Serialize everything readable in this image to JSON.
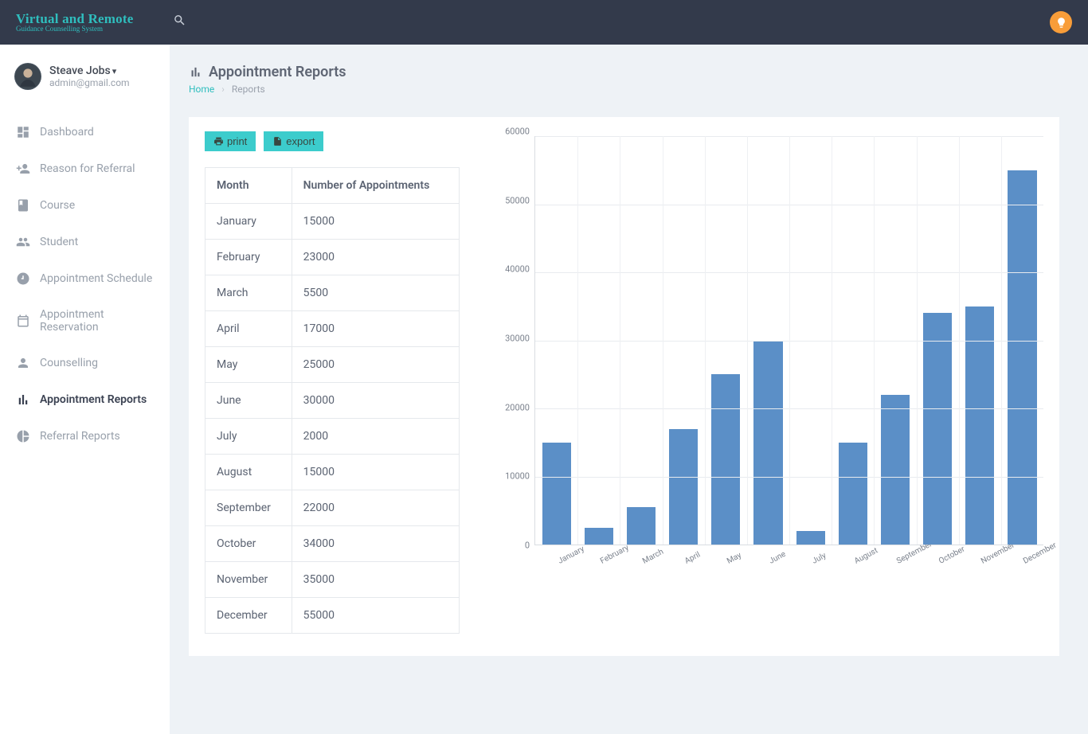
{
  "brand": {
    "title": "Virtual and Remote",
    "subtitle": "Guidance Counselling System"
  },
  "user": {
    "name": "Steave Jobs",
    "email": "admin@gmail.com"
  },
  "sidebar": {
    "items": [
      {
        "label": "Dashboard",
        "icon": "dashboard-icon",
        "active": false
      },
      {
        "label": "Reason for Referral",
        "icon": "person-plus-icon",
        "active": false
      },
      {
        "label": "Course",
        "icon": "book-icon",
        "active": false
      },
      {
        "label": "Student",
        "icon": "people-icon",
        "active": false
      },
      {
        "label": "Appointment Schedule",
        "icon": "clock-icon",
        "active": false
      },
      {
        "label": "Appointment Reservation",
        "icon": "calendar-icon",
        "active": false
      },
      {
        "label": "Counselling",
        "icon": "counselling-icon",
        "active": false
      },
      {
        "label": "Appointment Reports",
        "icon": "bar-chart-icon",
        "active": true
      },
      {
        "label": "Referral Reports",
        "icon": "pie-chart-icon",
        "active": false
      }
    ]
  },
  "page": {
    "title": "Appointment Reports",
    "breadcrumb_home": "Home",
    "breadcrumb_current": "Reports"
  },
  "actions": {
    "print": "print",
    "export": "export"
  },
  "table": {
    "headers": {
      "month": "Month",
      "num": "Number of Appointments"
    },
    "rows": [
      {
        "month": "January",
        "value": "15000"
      },
      {
        "month": "February",
        "value": "23000"
      },
      {
        "month": "March",
        "value": "5500"
      },
      {
        "month": "April",
        "value": "17000"
      },
      {
        "month": "May",
        "value": "25000"
      },
      {
        "month": "June",
        "value": "30000"
      },
      {
        "month": "July",
        "value": "2000"
      },
      {
        "month": "August",
        "value": "15000"
      },
      {
        "month": "September",
        "value": "22000"
      },
      {
        "month": "October",
        "value": "34000"
      },
      {
        "month": "November",
        "value": "35000"
      },
      {
        "month": "December",
        "value": "55000"
      }
    ]
  },
  "chart_data": {
    "type": "bar",
    "categories": [
      "January",
      "February",
      "March",
      "April",
      "May",
      "June",
      "July",
      "August",
      "September",
      "October",
      "November",
      "December"
    ],
    "values": [
      15000,
      2500,
      5500,
      17000,
      25000,
      30000,
      2000,
      15000,
      22000,
      34000,
      35000,
      55000
    ],
    "ylim": [
      0,
      60000
    ],
    "yticks": [
      0,
      10000,
      20000,
      30000,
      40000,
      50000,
      60000
    ],
    "xlabel": "",
    "ylabel": "",
    "title": ""
  },
  "colors": {
    "accent": "#2fbebe",
    "bar": "#5b8fc7",
    "topbar": "#333a4b"
  }
}
